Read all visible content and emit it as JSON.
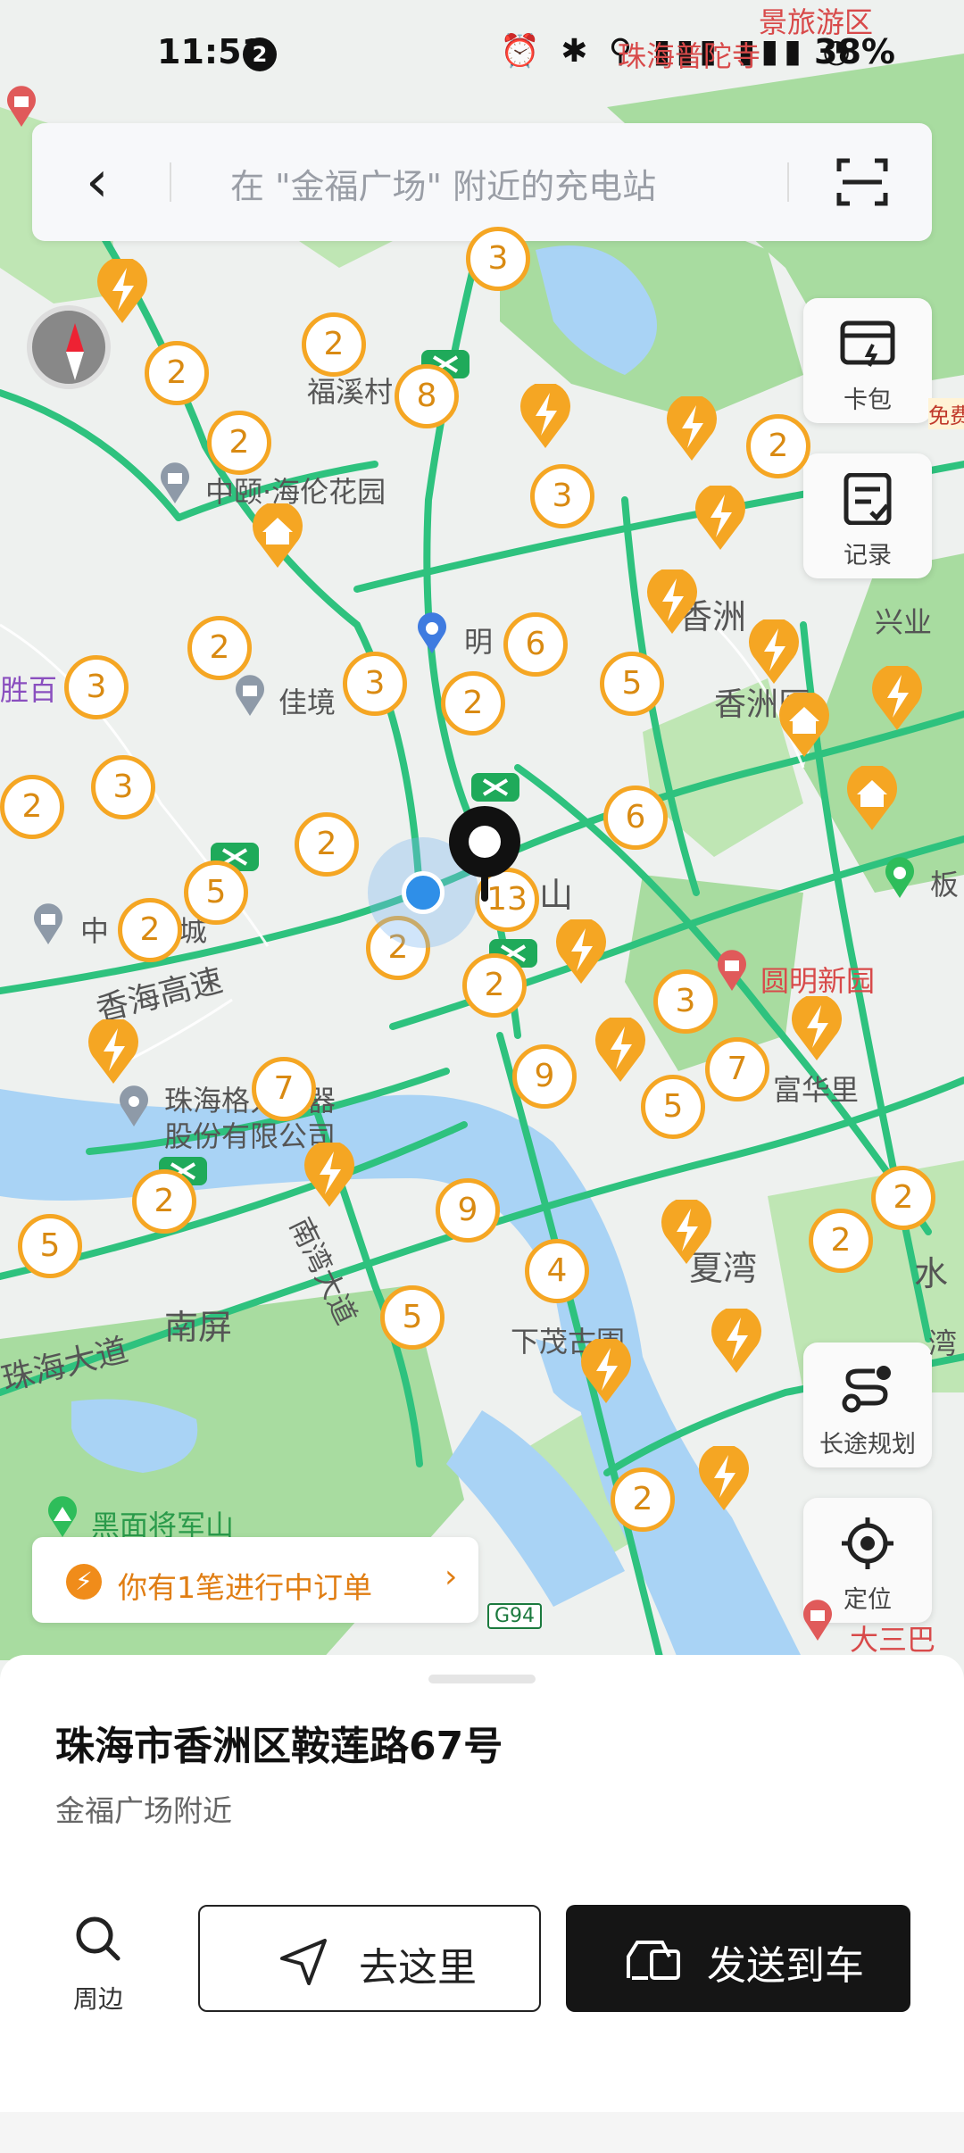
{
  "status_bar": {
    "time": "11:51",
    "notification_count": "2",
    "battery": "38%"
  },
  "search": {
    "placeholder": "在 \"金福广场\" 附近的充电站"
  },
  "side_buttons": {
    "wallet": "卡包",
    "records": "记录",
    "route_planning": "长途规划",
    "locate": "定位"
  },
  "map": {
    "place_labels": [
      "福溪村",
      "中颐·海伦花园",
      "佳境",
      "明",
      "香洲",
      "香洲区",
      "兴业",
      "胜百",
      "中",
      "城",
      "山",
      "圆明新园",
      "珠海格力电器",
      "股份有限公司",
      "富华里",
      "夏湾",
      "南屏",
      "下茂古围",
      "珠海大道",
      "香海高速",
      "南湾大道",
      "黑面将军山",
      "板",
      "水",
      "大三巴",
      "景旅游区",
      "珠海普陀寺",
      "湾",
      "免费"
    ],
    "road_badges": [
      "G94"
    ],
    "clusters": [
      "3",
      "2",
      "2",
      "8",
      "2",
      "2",
      "3",
      "2",
      "6",
      "3",
      "5",
      "2",
      "3",
      "3",
      "2",
      "6",
      "5",
      "2",
      "2",
      "13",
      "2",
      "2",
      "3",
      "9",
      "7",
      "5",
      "7",
      "2",
      "5",
      "2",
      "9",
      "2",
      "4",
      "5",
      "2"
    ]
  },
  "order_bar": {
    "text": "你有1笔进行中订单"
  },
  "sheet": {
    "address": "珠海市香洲区鞍莲路67号",
    "subtitle": "金福广场附近",
    "nearby_label": "周边",
    "go_label": "去这里",
    "send_label": "发送到车"
  },
  "colors": {
    "accent": "#f5a623",
    "road": "#2ec27e",
    "water": "#a9d3f5",
    "green": "#a8dca0",
    "button_dark": "#151515"
  }
}
